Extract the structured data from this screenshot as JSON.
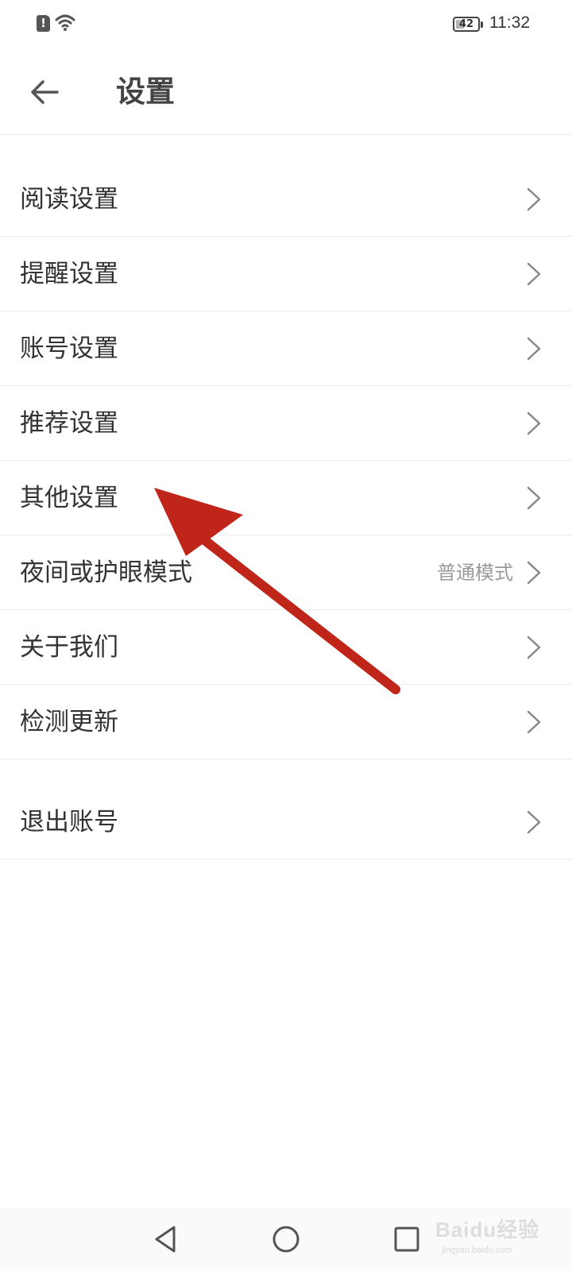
{
  "status_bar": {
    "sim_alert_glyph": "!",
    "battery_level": "42",
    "time": "11:32"
  },
  "header": {
    "back_icon": "arrow-left-icon",
    "title": "设置"
  },
  "settings": {
    "items": [
      {
        "label": "阅读设置",
        "value": ""
      },
      {
        "label": "提醒设置",
        "value": ""
      },
      {
        "label": "账号设置",
        "value": ""
      },
      {
        "label": "推荐设置",
        "value": ""
      },
      {
        "label": "其他设置",
        "value": ""
      },
      {
        "label": "夜间或护眼模式",
        "value": "普通模式"
      },
      {
        "label": "关于我们",
        "value": ""
      },
      {
        "label": "检测更新",
        "value": ""
      }
    ],
    "logout": {
      "label": "退出账号"
    }
  },
  "navigation": {
    "back_icon": "triangle-back-icon",
    "home_icon": "circle-home-icon",
    "recent_icon": "square-recent-icon"
  },
  "watermark": {
    "brand": "Baidu经验",
    "url": "jingyan.baidu.com"
  },
  "colors": {
    "annotation_arrow": "#c0251a",
    "text_primary": "#333333",
    "text_secondary": "#9a9a9a",
    "divider": "#ececec"
  }
}
